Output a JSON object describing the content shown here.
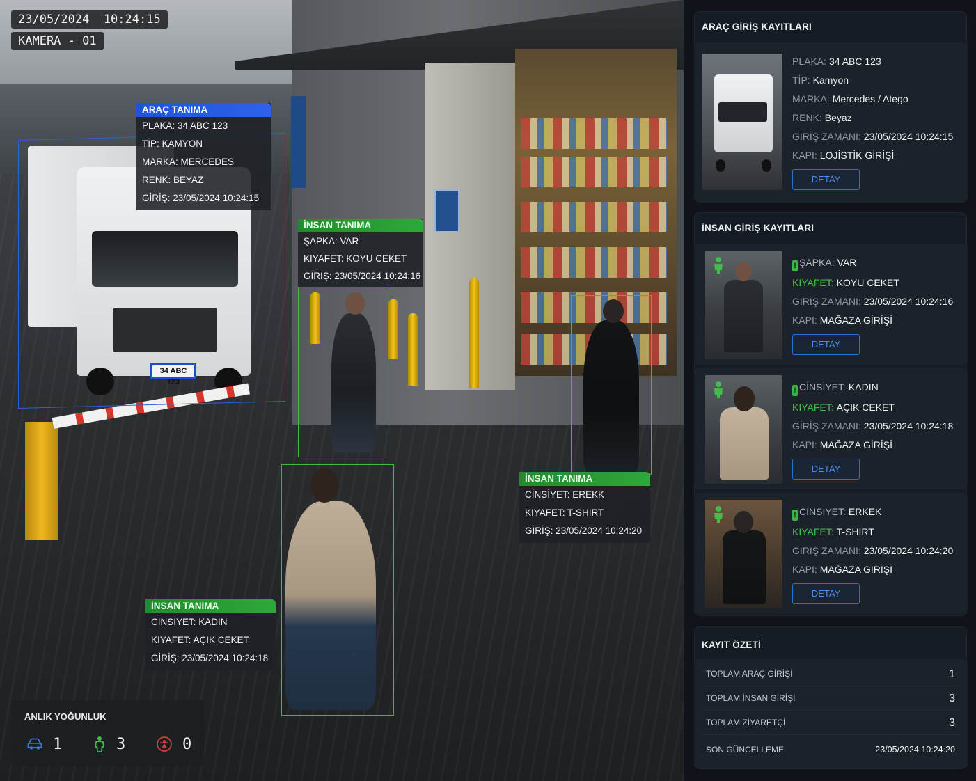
{
  "overlay": {
    "timestamp": "23/05/2024  10:24:15",
    "camera": "KAMERA - 01",
    "truck_plate": "34 ABC 123",
    "vehicle_label": {
      "title": "ARAÇ TANIMA",
      "rows": [
        "PLAKA: 34 ABC 123",
        "TİP: KAMYON",
        "MARKA: MERCEDES",
        "RENK: BEYAZ",
        "GİRİŞ: 23/05/2024 10:24:15"
      ]
    },
    "person1_label": {
      "title": "İNSAN TANIMA",
      "rows": [
        "ŞAPKA: VAR",
        "KIYAFET: KOYU CEKET",
        "GİRİŞ: 23/05/2024 10:24:16"
      ]
    },
    "person2_label": {
      "title": "İNSAN TANIMA",
      "rows": [
        "CİNSİYET: EREKK",
        "KIYAFET: T-SHIRT",
        "GİRİŞ: 23/05/2024 10:24:20"
      ]
    },
    "person3_label": {
      "title": "İNSAN TANIMA",
      "rows": [
        "CİNSİYET: KADIN",
        "KIYAFET: AÇIK CEKET",
        "GİRİŞ: 23/05/2024 10:24:18"
      ]
    },
    "density": {
      "title": "ANLIK YOĞUNLUK",
      "vehicles": "1",
      "people": "3",
      "alerts": "0"
    }
  },
  "vehicle_log": {
    "title": "ARAÇ GİRİŞ KAYITLARI",
    "entry": {
      "fields": [
        {
          "k": "PLAKA:",
          "v": "34 ABC 123"
        },
        {
          "k": "TİP:",
          "v": "Kamyon"
        },
        {
          "k": "MARKA:",
          "v": "Mercedes / Atego"
        },
        {
          "k": "RENK:",
          "v": "Beyaz"
        },
        {
          "k": "GİRİŞ ZAMANI:",
          "v": "23/05/2024 10:24:15"
        },
        {
          "k": "KAPI:",
          "v": "LOJİSTİK GİRİŞİ"
        }
      ],
      "button": "DETAY"
    }
  },
  "people_log": {
    "title": "İNSAN GİRİŞ KAYITLARI",
    "entries": [
      {
        "f1k": "ŞAPKA:",
        "f1v": "VAR",
        "f2k": "KIYAFET:",
        "f2v": "KOYU CEKET",
        "f3k": "GİRİŞ ZAMANI:",
        "f3v": "23/05/2024 10:24:16",
        "f4k": "KAPI:",
        "f4v": "MAĞAZA GİRİŞİ",
        "button": "DETAY"
      },
      {
        "f1k": "CİNSİYET:",
        "f1v": "KADIN",
        "f2k": "KIYAFET:",
        "f2v": "AÇIK CEKET",
        "f3k": "GİRİŞ ZAMANI:",
        "f3v": "23/05/2024 10:24:18",
        "f4k": "KAPI:",
        "f4v": "MAĞAZA GİRİŞİ",
        "button": "DETAY"
      },
      {
        "f1k": "CİNSİYET:",
        "f1v": "ERKEK",
        "f2k": "KIYAFET:",
        "f2v": "T-SHIRT",
        "f3k": "GİRİŞ ZAMANI:",
        "f3v": "23/05/2024 10:24:20",
        "f4k": "KAPI:",
        "f4v": "MAĞAZA GİRİŞİ",
        "button": "DETAY"
      }
    ]
  },
  "summary": {
    "title": "KAYIT ÖZETİ",
    "rows": [
      {
        "k": "TOPLAM ARAÇ GİRİŞİ",
        "v": "1"
      },
      {
        "k": "TOPLAM İNSAN GİRİŞİ",
        "v": "3"
      },
      {
        "k": "TOPLAM ZİYARETÇİ",
        "v": "3"
      },
      {
        "k": "SON GÜNCELLEME",
        "v": "23/05/2024 10:24:20"
      }
    ]
  },
  "colors": {
    "vehicle_accent": "#2a63ea",
    "person_accent": "#2ea83a",
    "button": "#2c6fd1"
  }
}
